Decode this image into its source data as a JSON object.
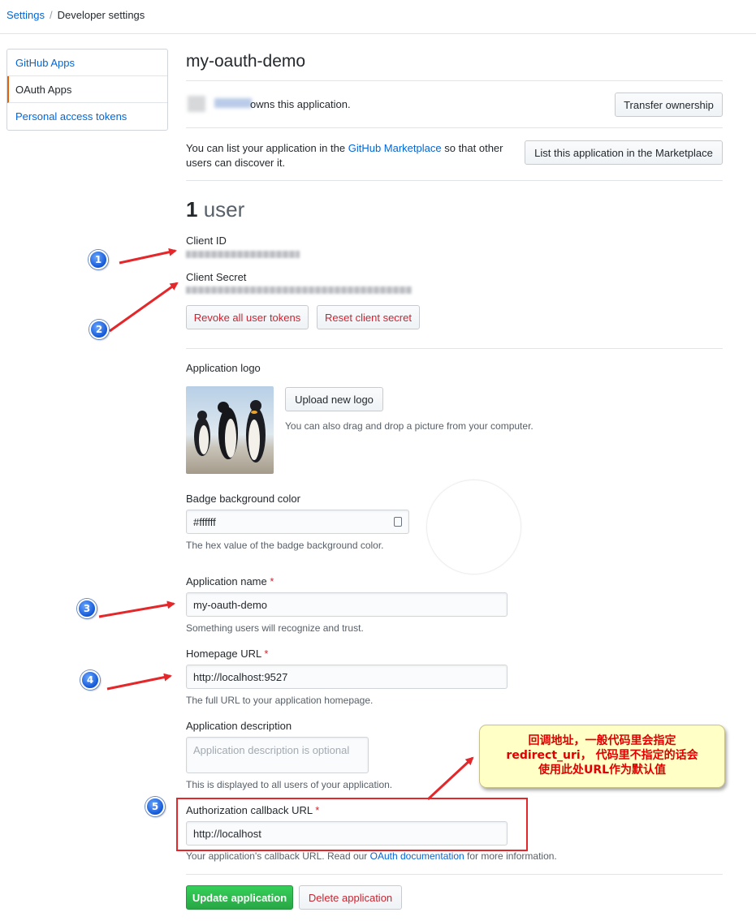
{
  "breadcrumb": {
    "root": "Settings",
    "current": "Developer settings"
  },
  "sidebar": {
    "items": [
      {
        "label": "GitHub Apps"
      },
      {
        "label": "OAuth Apps"
      },
      {
        "label": "Personal access tokens"
      }
    ]
  },
  "app": {
    "title": "my-oauth-demo",
    "owns_text": "owns this application.",
    "transfer_label": "Transfer ownership",
    "marketplace_text_pre": "You can list your application in the ",
    "marketplace_link": "GitHub Marketplace",
    "marketplace_text_post": " so that other users can discover it.",
    "marketplace_button": "List this application in the Marketplace",
    "user_count": "1",
    "user_word": "user",
    "client_id_label": "Client ID",
    "client_secret_label": "Client Secret",
    "revoke_label": "Revoke all user tokens",
    "reset_label": "Reset client secret"
  },
  "logo": {
    "label": "Application logo",
    "upload_label": "Upload new logo",
    "drag_hint": "You can also drag and drop a picture from your computer."
  },
  "form": {
    "badge_label": "Badge background color",
    "badge_value": "#ffffff",
    "badge_note": "The hex value of the badge background color.",
    "name_label": "Application name",
    "name_value": "my-oauth-demo",
    "name_note": "Something users will recognize and trust.",
    "homepage_label": "Homepage URL",
    "homepage_value": "http://localhost:9527",
    "homepage_note": "The full URL to your application homepage.",
    "desc_label": "Application description",
    "desc_placeholder": "Application description is optional",
    "desc_note": "This is displayed to all users of your application.",
    "callback_label": "Authorization callback URL",
    "callback_value": "http://localhost",
    "callback_note_pre": "Your application's callback URL. Read our ",
    "callback_note_link": "OAuth documentation",
    "callback_note_post": " for more information.",
    "required_mark": "*",
    "update_label": "Update application",
    "delete_label": "Delete application"
  },
  "annotations": {
    "numbers": [
      "1",
      "2",
      "3",
      "4",
      "5"
    ],
    "callout_lines": [
      "回调地址，一般代码里会指定",
      "redirect_uri， 代码里不指定的话会",
      "使用此处URL作为默认值"
    ]
  },
  "colors": {
    "link": "#0366d6",
    "danger": "#cb2431",
    "primary": "#28a745",
    "annotation_red": "#e3272a",
    "callout_bg": "#ffffc6"
  }
}
